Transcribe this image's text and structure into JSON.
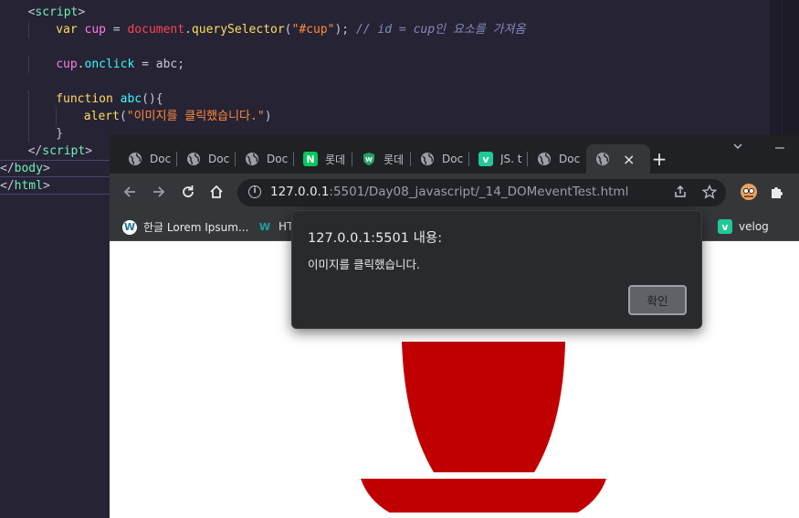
{
  "editor": {
    "lines": [
      {
        "indent": 1,
        "parts": [
          [
            "punc",
            "<"
          ],
          [
            "tag",
            "script"
          ],
          [
            "punc",
            ">"
          ]
        ]
      },
      {
        "indent": 2,
        "parts": [
          [
            "kw",
            "var"
          ],
          [
            "punc",
            " "
          ],
          [
            "var",
            "cup"
          ],
          [
            "punc",
            " = "
          ],
          [
            "obj",
            "document"
          ],
          [
            "punc",
            "."
          ],
          [
            "callname",
            "querySelector"
          ],
          [
            "punc",
            "("
          ],
          [
            "str",
            "\"#cup\""
          ],
          [
            "punc",
            "); "
          ],
          [
            "cmt",
            "// id = cup인 요소를 가져옴"
          ]
        ]
      },
      {
        "indent": 0,
        "parts": []
      },
      {
        "indent": 2,
        "parts": [
          [
            "var",
            "cup"
          ],
          [
            "punc",
            "."
          ],
          [
            "fn",
            "onclick"
          ],
          [
            "punc",
            " = "
          ],
          [
            "punc",
            "abc;"
          ]
        ]
      },
      {
        "indent": 0,
        "parts": []
      },
      {
        "indent": 2,
        "parts": [
          [
            "kw",
            "function"
          ],
          [
            "punc",
            " "
          ],
          [
            "fnname",
            "abc"
          ],
          [
            "punc",
            "(){"
          ]
        ]
      },
      {
        "indent": 3,
        "parts": [
          [
            "callname",
            "alert"
          ],
          [
            "punc",
            "("
          ],
          [
            "str",
            "\"이미지를 클릭했습니다.\""
          ],
          [
            "punc",
            ")"
          ]
        ]
      },
      {
        "indent": 2,
        "parts": [
          [
            "punc",
            "}"
          ]
        ]
      },
      {
        "indent": 1,
        "parts": [
          [
            "punc",
            "</"
          ],
          [
            "tag",
            "script"
          ],
          [
            "punc",
            ">"
          ]
        ]
      },
      {
        "indent": 0,
        "parts": [
          [
            "punc",
            "</"
          ],
          [
            "tag",
            "body"
          ],
          [
            "punc",
            ">"
          ]
        ]
      },
      {
        "indent": 0,
        "parts": [
          [
            "punc",
            "</"
          ],
          [
            "tag",
            "html"
          ],
          [
            "punc",
            ">"
          ]
        ]
      }
    ]
  },
  "browser": {
    "tabs": [
      {
        "label": "Doc",
        "icon": "globe-icon",
        "glyph": "",
        "color": "#9aa0a6"
      },
      {
        "label": "Doc",
        "icon": "globe-icon",
        "glyph": "",
        "color": "#9aa0a6"
      },
      {
        "label": "Doc",
        "icon": "globe-icon",
        "glyph": "",
        "color": "#9aa0a6"
      },
      {
        "label": "롯데",
        "icon": "naver-icon",
        "glyph": "N",
        "color": "#03c75a"
      },
      {
        "label": "롯데",
        "icon": "shield-icon",
        "glyph": "W",
        "color": "#21a366"
      },
      {
        "label": "Doc",
        "icon": "globe-icon",
        "glyph": "",
        "color": "#9aa0a6"
      },
      {
        "label": "JS. t",
        "icon": "velog-icon",
        "glyph": "v",
        "color": "#20c997"
      },
      {
        "label": "Doc",
        "icon": "globe-icon",
        "glyph": "",
        "color": "#9aa0a6"
      },
      {
        "label": "",
        "icon": "globe-icon",
        "glyph": "",
        "color": "#9aa0a6",
        "active": true
      }
    ],
    "new_tab": "+",
    "close_tab": "×",
    "url_host": "127.0.0.1",
    "url_rest": ":5501/Day08_javascript/_14_DOMeventTest.html",
    "bookmarks": [
      {
        "label": "한글 Lorem Ipsum...",
        "icon": "wordpress-icon",
        "glyph": "W",
        "color": "#ffffff"
      },
      {
        "label": "HT",
        "icon": "w-logo-icon",
        "glyph": "W",
        "color": "#1ba39c"
      },
      {
        "label": "velog",
        "icon": "velog-icon",
        "glyph": "v",
        "color": "#20c997"
      }
    ]
  },
  "dialog": {
    "title": "127.0.0.1:5501 내용:",
    "message": "이미지를 클릭했습니다.",
    "ok_label": "확인"
  },
  "colors": {
    "cup": "#c00000",
    "editor_bg": "#262335",
    "browser_bg": "#202124"
  }
}
